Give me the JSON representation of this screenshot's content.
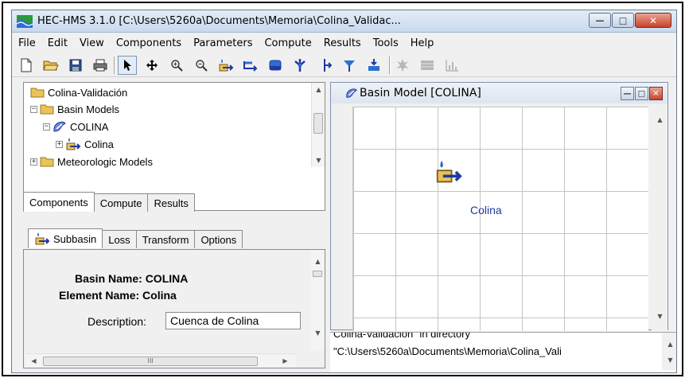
{
  "window": {
    "title": "HEC-HMS 3.1.0 [C:\\Users\\5260a\\Documents\\Memoria\\Colina_Validac...",
    "minimize_glyph": "—",
    "maximize_glyph": "□",
    "close_glyph": "✕"
  },
  "menu": [
    "File",
    "Edit",
    "View",
    "Components",
    "Parameters",
    "Compute",
    "Results",
    "Tools",
    "Help"
  ],
  "toolbar": {
    "icons": [
      "new-file-icon",
      "open-folder-icon",
      "save-icon",
      "print-icon",
      "arrow-select-icon",
      "move-pan-icon",
      "zoom-in-icon",
      "zoom-out-icon",
      "subbasin-tool-icon",
      "reach-tool-icon",
      "reservoir-tool-icon",
      "junction-tool-icon",
      "diversion-tool-icon",
      "source-tool-icon",
      "sink-tool-icon",
      "compute-icon",
      "global-summary-icon",
      "graph-icon"
    ]
  },
  "tree": {
    "items": [
      {
        "label": "Colina-Validación",
        "icon": "folder-icon"
      },
      {
        "label": "Basin Models",
        "icon": "folder-icon",
        "expander": "−"
      },
      {
        "label": "COLINA",
        "icon": "basin-model-icon",
        "expander": "−"
      },
      {
        "label": "Colina",
        "icon": "subbasin-icon",
        "expander": "+"
      },
      {
        "label": "Meteorologic Models",
        "icon": "folder-icon",
        "expander": "+"
      }
    ],
    "tabs": [
      "Components",
      "Compute",
      "Results"
    ],
    "active_tab": "Components"
  },
  "properties": {
    "tabs": [
      "Subbasin",
      "Loss",
      "Transform",
      "Options"
    ],
    "active_tab": "Subbasin",
    "basin_name": "Basin Name: COLINA",
    "element_name": "Element Name: Colina",
    "description_label": "Description:",
    "description_value": "Cuenca de Colina",
    "hscroll_grip": "III"
  },
  "basin_window": {
    "title": "Basin Model [COLINA]",
    "element_label": "Colina"
  },
  "messages": {
    "line1": "Colina-Validación\" in directory",
    "line2": "\"C:\\Users\\5260a\\Documents\\Memoria\\Colina_Vali"
  },
  "colors": {
    "title_gradient_top": "#e3ecf7",
    "element_label": "#1e3aa0",
    "close_button": "#c8422a"
  }
}
